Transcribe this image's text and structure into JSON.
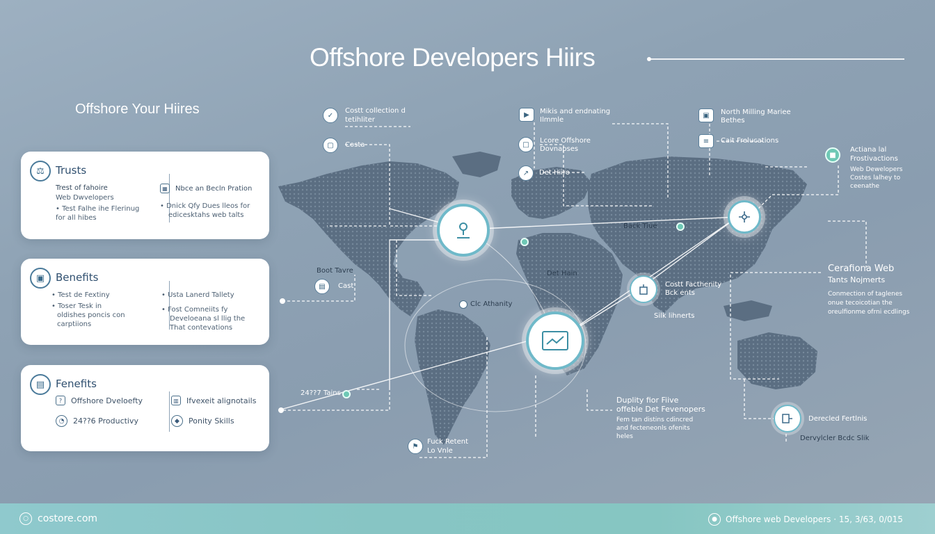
{
  "title": "Offshore Developers Hiirs",
  "subtitle": "Offshore Your Hiires",
  "cards": {
    "trusts": {
      "title": "Trusts",
      "left_lines": [
        "Trest of fahoire",
        "Web Dwvelopers",
        "• Test Falhe ihe Flerinug",
        "for all hibes"
      ],
      "right_head": "Nbce an Becln Pration",
      "right_lines": [
        "• Dnick Qfy Dues lleos for",
        "edicesktahs web talts"
      ]
    },
    "benefits": {
      "title": "Benefits",
      "left_lines": [
        "• Test de Fextiny",
        "• Toser Tesk in",
        "oldishes poncis con",
        "carptiions"
      ],
      "right_lines": [
        "• Usta Lanerd Tallety",
        "• Fost Comneiits fy",
        "Develoeana sl llig the",
        "That contevations"
      ]
    },
    "fenefits": {
      "title": "Fenefits",
      "items": [
        "Offshore Dveloefty",
        "24??6 Productivy",
        "Ifvexeit alignotails",
        "Ponity Skills"
      ]
    }
  },
  "map": {
    "labels": {
      "cost_collection": [
        "Costt collection d",
        "tetihliter"
      ],
      "costa": "Costa",
      "mikis": [
        "Mikis and endnating",
        "Ilmmle"
      ],
      "lcore": [
        "Lcore Offshore",
        "Dovnapses"
      ],
      "det_hiiro": "Det Hiiro",
      "north_milling": [
        "North Milling Mariee",
        "Bethes"
      ],
      "cait_frelucations": "Cait Frelucations",
      "actiana": [
        "Actiana lal",
        "Frostivactions",
        "Web Dewelopers",
        "Costes lalhey to",
        "ceenathe"
      ],
      "back_tiue": "Back Tiue",
      "det_hain": "Det Hain",
      "boot_tavre": "Boot Tavre",
      "cast": "Cast",
      "cost_facthenity": [
        "Costt Facthenity",
        "Bck ents"
      ],
      "cerafiona": [
        "Cerafiona Web",
        "Tants Nojmerts"
      ],
      "cerafiona_desc": [
        "Conmection of taglenes",
        "onue tecoicotian the",
        "oreulfionme ofrni ecdlings"
      ],
      "clc_athanity": "Clc Athanity",
      "silk_lihnerts": "Silk lihnerts",
      "hours": "24??7 Tains",
      "duplity": [
        "Duplity fior Fiive",
        "offeble Det Fevenopers"
      ],
      "duplity_desc": [
        "Fem tan distins cdincred",
        "and fecteneonls ofenits",
        "heles"
      ],
      "fuck_retent": [
        "Fuck Retent",
        "Lo Vnle"
      ],
      "derecled": "Derecled Fertlnis",
      "dervylcler": "Dervylcler Bcdc Slik"
    }
  },
  "footer": {
    "left": "costore.com",
    "right": "Offshore web Developers · 15, 3/63, 0/015"
  },
  "colors": {
    "accent_teal": "#6fb9c9",
    "footer": "#87c5c4",
    "dot_teal": "#6ec8b5"
  }
}
